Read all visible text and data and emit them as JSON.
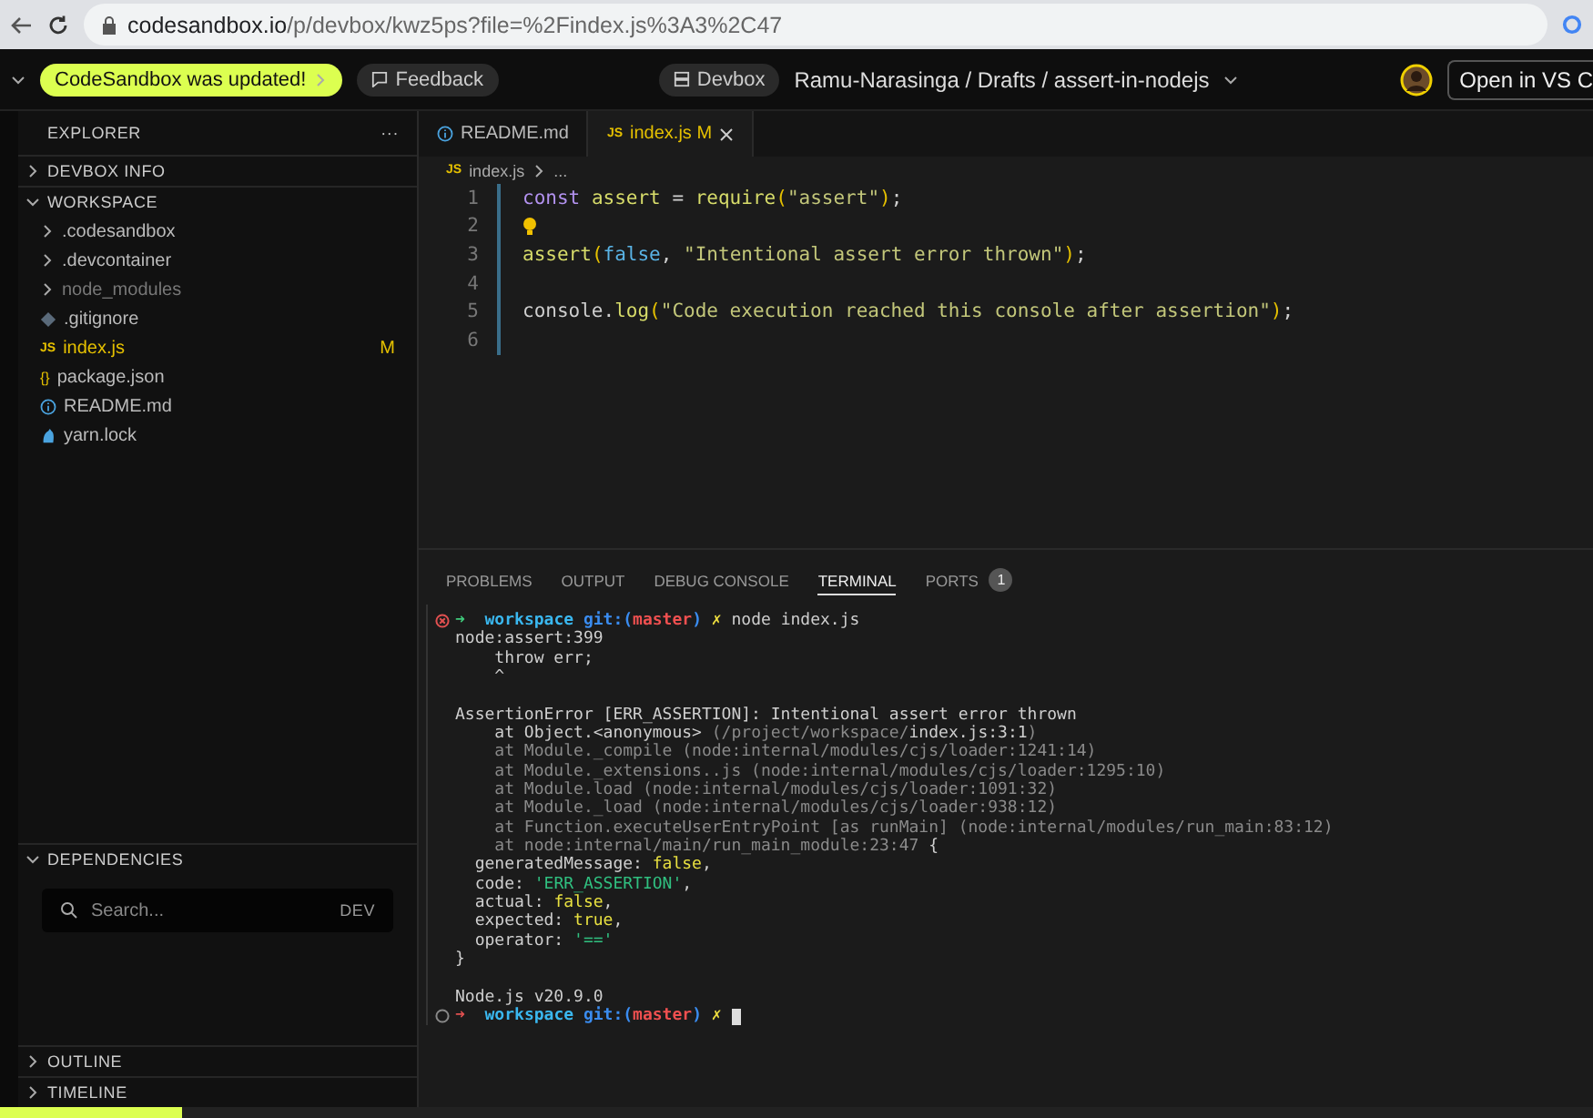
{
  "browser": {
    "host": "codesandbox.io",
    "path": "/p/devbox/kwz5ps?file=%2Findex.js%3A3%2C47"
  },
  "header": {
    "update_badge": "CodeSandbox was updated!",
    "feedback": "Feedback",
    "devbox": "Devbox",
    "project_path": "Ramu-Narasinga / Drafts / assert-in-nodejs",
    "open_button": "Open in VS C"
  },
  "sidebar": {
    "title": "EXPLORER",
    "menu": "···",
    "sections": [
      {
        "label": "DEVBOX INFO",
        "expanded": false
      },
      {
        "label": "WORKSPACE",
        "expanded": true
      }
    ],
    "items": [
      {
        "kind": "folder",
        "name": ".codesandbox",
        "dim": false,
        "modified": false
      },
      {
        "kind": "folder",
        "name": ".devcontainer",
        "dim": false,
        "modified": false
      },
      {
        "kind": "folder",
        "name": "node_modules",
        "dim": true,
        "modified": false
      },
      {
        "kind": "git",
        "name": ".gitignore",
        "dim": false,
        "modified": false
      },
      {
        "kind": "js",
        "icon": "JS",
        "name": "index.js",
        "dim": false,
        "modified": true,
        "badge": "M"
      },
      {
        "kind": "json",
        "icon": "{}",
        "name": "package.json",
        "dim": false,
        "modified": false
      },
      {
        "kind": "info",
        "name": "README.md",
        "dim": false,
        "modified": false
      },
      {
        "kind": "yarn",
        "name": "yarn.lock",
        "dim": false,
        "modified": false
      }
    ],
    "dependencies": {
      "label": "DEPENDENCIES",
      "expanded": true,
      "placeholder": "Search...",
      "tag": "DEV"
    },
    "bottom_sections": [
      {
        "label": "OUTLINE",
        "expanded": false
      },
      {
        "label": "TIMELINE",
        "expanded": false
      }
    ]
  },
  "editor": {
    "tabs": [
      {
        "kind": "info",
        "label": "README.md",
        "selected": false
      },
      {
        "kind": "js",
        "icon": "JS",
        "label": "index.js",
        "badge": "M",
        "selected": true
      }
    ],
    "breadcrumb": {
      "icon": "JS",
      "file": "index.js",
      "more": "..."
    },
    "lines": [
      {
        "number": "1",
        "bulb": false,
        "tokens": [
          {
            "kind": "keyword",
            "text": "const "
          },
          {
            "kind": "variable",
            "text": "assert"
          },
          {
            "kind": "plain",
            "text": " = "
          },
          {
            "kind": "func",
            "text": "require"
          },
          {
            "kind": "punct",
            "text": "("
          },
          {
            "kind": "string",
            "text": "\"assert\""
          },
          {
            "kind": "punct",
            "text": ")"
          },
          {
            "kind": "plain",
            "text": ";"
          }
        ]
      },
      {
        "number": "2",
        "bulb": true
      },
      {
        "number": "3",
        "bulb": false,
        "tokens": [
          {
            "kind": "func",
            "text": "assert"
          },
          {
            "kind": "punct",
            "text": "("
          },
          {
            "kind": "bool",
            "text": "false"
          },
          {
            "kind": "plain",
            "text": ", "
          },
          {
            "kind": "string",
            "text": "\"Intentional assert error thrown\""
          },
          {
            "kind": "punct",
            "text": ")"
          },
          {
            "kind": "plain",
            "text": ";"
          }
        ]
      },
      {
        "number": "4",
        "bulb": false
      },
      {
        "number": "5",
        "bulb": false,
        "tokens": [
          {
            "kind": "plain",
            "text": "console."
          },
          {
            "kind": "func",
            "text": "log"
          },
          {
            "kind": "punct",
            "text": "("
          },
          {
            "kind": "string",
            "text": "\"Code execution reached this console after assertion\""
          },
          {
            "kind": "punct",
            "text": ")"
          },
          {
            "kind": "plain",
            "text": ";"
          }
        ]
      },
      {
        "number": "6",
        "bulb": false
      }
    ]
  },
  "panel": {
    "tabs": [
      {
        "label": "PROBLEMS",
        "selected": false
      },
      {
        "label": "OUTPUT",
        "selected": false
      },
      {
        "label": "DEBUG CONSOLE",
        "selected": false
      },
      {
        "label": "TERMINAL",
        "selected": true
      },
      {
        "label": "PORTS",
        "selected": false,
        "count": "1"
      }
    ],
    "terminal": [
      {
        "kind": "prompt",
        "failed": true,
        "tokens": [
          {
            "kind": "arrow-ok",
            "text": "➜  "
          },
          {
            "kind": "dir",
            "text": "workspace "
          },
          {
            "kind": "git",
            "text": "git:("
          },
          {
            "kind": "branch",
            "text": "master"
          },
          {
            "kind": "git",
            "text": ") "
          },
          {
            "kind": "dirty",
            "text": "✗ "
          },
          {
            "kind": "plain",
            "text": "node index.js"
          }
        ]
      },
      {
        "kind": "output",
        "tokens": [
          {
            "kind": "plain",
            "text": "node:assert:399"
          }
        ]
      },
      {
        "kind": "output",
        "tokens": [
          {
            "kind": "plain",
            "text": "    throw err;"
          }
        ]
      },
      {
        "kind": "output",
        "tokens": [
          {
            "kind": "plain",
            "text": "    ^"
          }
        ]
      },
      {
        "kind": "blank"
      },
      {
        "kind": "output",
        "tokens": [
          {
            "kind": "plain",
            "text": "AssertionError [ERR_ASSERTION]: Intentional assert error thrown"
          }
        ]
      },
      {
        "kind": "output",
        "tokens": [
          {
            "kind": "plain",
            "text": "    at Object.<anonymous> "
          },
          {
            "kind": "dim",
            "text": "(/project/workspace/"
          },
          {
            "kind": "plain",
            "text": "index.js:3:1"
          },
          {
            "kind": "dim",
            "text": ")"
          }
        ]
      },
      {
        "kind": "output",
        "tokens": [
          {
            "kind": "dim",
            "text": "    at Module._compile (node:internal/modules/cjs/loader:1241:14)"
          }
        ]
      },
      {
        "kind": "output",
        "tokens": [
          {
            "kind": "dim",
            "text": "    at Module._extensions..js (node:internal/modules/cjs/loader:1295:10)"
          }
        ]
      },
      {
        "kind": "output",
        "tokens": [
          {
            "kind": "dim",
            "text": "    at Module.load (node:internal/modules/cjs/loader:1091:32)"
          }
        ]
      },
      {
        "kind": "output",
        "tokens": [
          {
            "kind": "dim",
            "text": "    at Module._load (node:internal/modules/cjs/loader:938:12)"
          }
        ]
      },
      {
        "kind": "output",
        "tokens": [
          {
            "kind": "dim",
            "text": "    at Function.executeUserEntryPoint [as runMain] (node:internal/modules/run_main:83:12)"
          }
        ]
      },
      {
        "kind": "output",
        "tokens": [
          {
            "kind": "dim",
            "text": "    at node:internal/main/run_main_module:23:47"
          },
          {
            "kind": "plain",
            "text": " {"
          }
        ]
      },
      {
        "kind": "output",
        "tokens": [
          {
            "kind": "plain",
            "text": "  generatedMessage: "
          },
          {
            "kind": "yellow",
            "text": "false"
          },
          {
            "kind": "plain",
            "text": ","
          }
        ]
      },
      {
        "kind": "output",
        "tokens": [
          {
            "kind": "plain",
            "text": "  code: "
          },
          {
            "kind": "green",
            "text": "'ERR_ASSERTION'"
          },
          {
            "kind": "plain",
            "text": ","
          }
        ]
      },
      {
        "kind": "output",
        "tokens": [
          {
            "kind": "plain",
            "text": "  actual: "
          },
          {
            "kind": "yellow",
            "text": "false"
          },
          {
            "kind": "plain",
            "text": ","
          }
        ]
      },
      {
        "kind": "output",
        "tokens": [
          {
            "kind": "plain",
            "text": "  expected: "
          },
          {
            "kind": "yellow",
            "text": "true"
          },
          {
            "kind": "plain",
            "text": ","
          }
        ]
      },
      {
        "kind": "output",
        "tokens": [
          {
            "kind": "plain",
            "text": "  operator: "
          },
          {
            "kind": "green",
            "text": "'=='"
          }
        ]
      },
      {
        "kind": "output",
        "tokens": [
          {
            "kind": "plain",
            "text": "}"
          }
        ]
      },
      {
        "kind": "blank"
      },
      {
        "kind": "output",
        "tokens": [
          {
            "kind": "plain",
            "text": "Node.js v20.9.0"
          }
        ]
      },
      {
        "kind": "prompt",
        "failed": false,
        "cursor": true,
        "tokens": [
          {
            "kind": "arrow-err",
            "text": "➜  "
          },
          {
            "kind": "dir",
            "text": "workspace "
          },
          {
            "kind": "git",
            "text": "git:("
          },
          {
            "kind": "branch",
            "text": "master"
          },
          {
            "kind": "git",
            "text": ") "
          },
          {
            "kind": "dirty",
            "text": "✗ "
          }
        ]
      }
    ]
  }
}
